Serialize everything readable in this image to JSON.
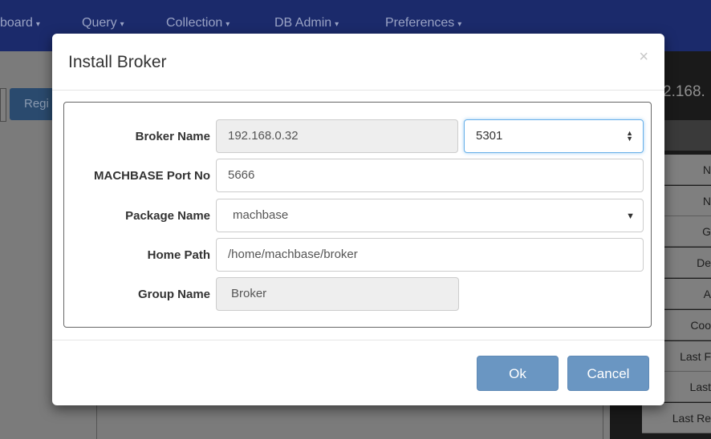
{
  "nav": {
    "items": [
      {
        "label": "board",
        "caret": "▾"
      },
      {
        "label": "Query",
        "caret": "▾"
      },
      {
        "label": "Collection",
        "caret": "▾"
      },
      {
        "label": "DB Admin",
        "caret": "▾"
      },
      {
        "label": "Preferences",
        "caret": "▾"
      }
    ]
  },
  "background": {
    "left_button_label": "Regi",
    "right_title": "2.168.",
    "right_cells": [
      "N",
      "N",
      "G",
      "De",
      "A",
      "Coo",
      "Last F",
      "Last",
      "Last Re"
    ]
  },
  "modal": {
    "title": "Install Broker",
    "close_symbol": "×",
    "fields": {
      "broker_name": {
        "label": "Broker Name",
        "value": "192.168.0.32",
        "port_value": "5301"
      },
      "machbase_port": {
        "label": "MACHBASE Port No",
        "value": "5666"
      },
      "package_name": {
        "label": "Package Name",
        "value": "machbase"
      },
      "home_path": {
        "label": "Home Path",
        "value": "/home/machbase/broker"
      },
      "group_name": {
        "label": "Group Name",
        "value": "Broker"
      }
    },
    "buttons": {
      "ok": "Ok",
      "cancel": "Cancel"
    }
  },
  "colors": {
    "navbar": "#1b2a6b",
    "button_primary": "#6a96c2",
    "focus_border": "#66afe9"
  }
}
